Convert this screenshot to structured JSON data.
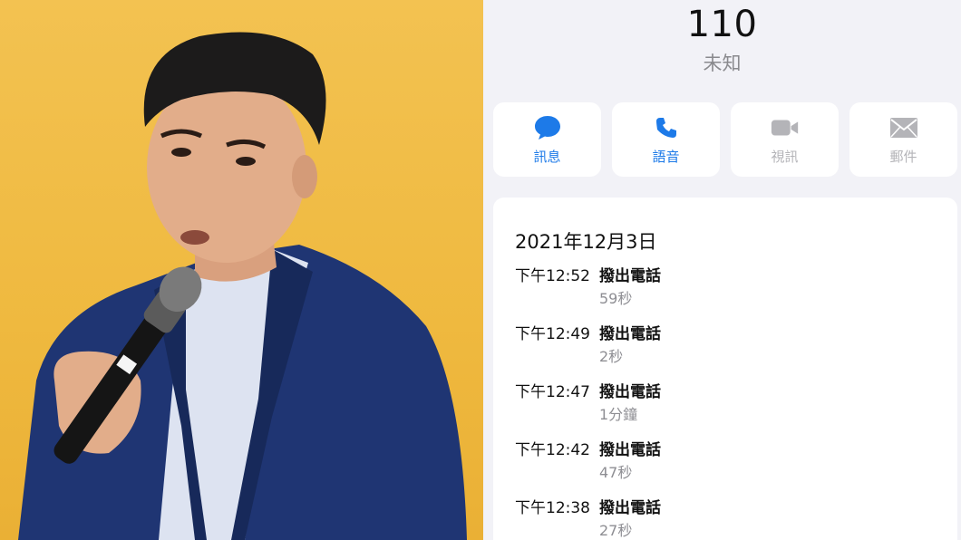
{
  "contact": {
    "number": "110",
    "label": "未知"
  },
  "actions": [
    {
      "label": "訊息",
      "icon": "message-bubble-icon",
      "enabled": true
    },
    {
      "label": "語音",
      "icon": "phone-icon",
      "enabled": true
    },
    {
      "label": "視訊",
      "icon": "video-camera-icon",
      "enabled": false
    },
    {
      "label": "郵件",
      "icon": "mail-envelope-icon",
      "enabled": false
    }
  ],
  "history": {
    "date": "2021年12月3日",
    "entries": [
      {
        "time": "下午12:52",
        "type": "撥出電話",
        "duration": "59秒"
      },
      {
        "time": "下午12:49",
        "type": "撥出電話",
        "duration": "2秒"
      },
      {
        "time": "下午12:47",
        "type": "撥出電話",
        "duration": "1分鐘"
      },
      {
        "time": "下午12:42",
        "type": "撥出電話",
        "duration": "47秒"
      },
      {
        "time": "下午12:38",
        "type": "撥出電話",
        "duration": "27秒"
      }
    ]
  },
  "colors": {
    "accent": "#1d7ae8",
    "disabled": "#b4b4b8",
    "photo_background": "#f0bb42"
  }
}
